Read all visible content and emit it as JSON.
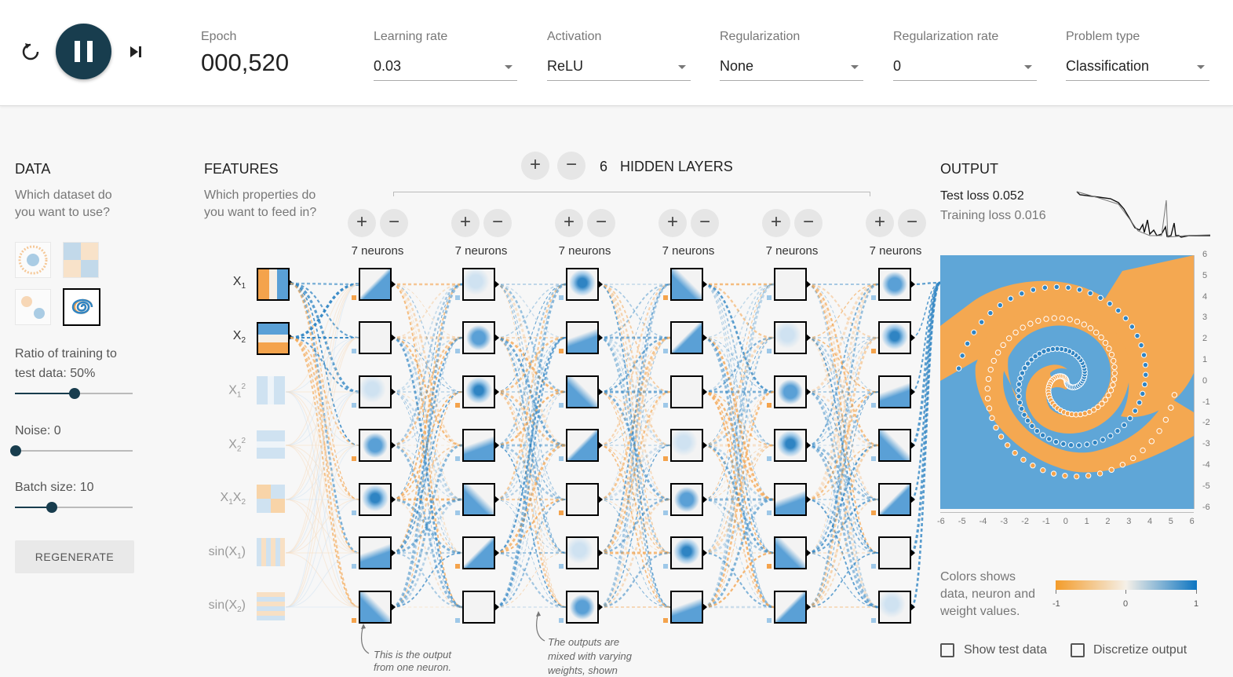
{
  "controls": {
    "epoch_label": "Epoch",
    "epoch_value": "000,520",
    "learning_rate_label": "Learning rate",
    "learning_rate_value": "0.03",
    "activation_label": "Activation",
    "activation_value": "ReLU",
    "regularization_label": "Regularization",
    "regularization_value": "None",
    "reg_rate_label": "Regularization rate",
    "reg_rate_value": "0",
    "problem_type_label": "Problem type",
    "problem_type_value": "Classification"
  },
  "data_panel": {
    "heading": "DATA",
    "question_line1": "Which dataset do",
    "question_line2": "you want to use?",
    "ratio_label_line1": "Ratio of training to",
    "ratio_label_line2": "test data:  50%",
    "ratio_value": 0.5,
    "noise_label": "Noise:  0",
    "noise_value": 0,
    "batch_label": "Batch size:  10",
    "batch_value": 10,
    "regenerate_label": "REGENERATE"
  },
  "features_panel": {
    "heading": "FEATURES",
    "question_line1": "Which properties do",
    "question_line2": "you want to feed in?"
  },
  "network": {
    "hidden_layers_count": "6",
    "hidden_layers_label": "HIDDEN LAYERS",
    "plus": "+",
    "minus": "−",
    "layers": [
      {
        "neurons": "7 neurons"
      },
      {
        "neurons": "7 neurons"
      },
      {
        "neurons": "7 neurons"
      },
      {
        "neurons": "7 neurons"
      },
      {
        "neurons": "7 neurons"
      },
      {
        "neurons": "7 neurons"
      }
    ],
    "annotation1_line1": "This is the output",
    "annotation1_line2": "from one neuron.",
    "annotation2_line1": "The outputs are",
    "annotation2_line2": "mixed with varying",
    "annotation2_line3": "weights, shown"
  },
  "output_panel": {
    "heading": "OUTPUT",
    "test_loss": "Test loss 0.052",
    "training_loss": "Training loss 0.016",
    "y_ticks": [
      "6",
      "5",
      "4",
      "3",
      "2",
      "1",
      "0",
      "-1",
      "-2",
      "-3",
      "-4",
      "-5",
      "-6"
    ],
    "x_ticks": [
      "-6",
      "-5",
      "-4",
      "-3",
      "-2",
      "-1",
      "0",
      "1",
      "2",
      "3",
      "4",
      "5",
      "6"
    ],
    "legend_text_line1": "Colors shows",
    "legend_text_line2": "data, neuron and",
    "legend_text_line3": "weight values.",
    "legend_min": "-1",
    "legend_mid": "0",
    "legend_max": "1",
    "show_test_data_label": "Show test data",
    "discretize_label": "Discretize output"
  },
  "colors": {
    "orange": "#f4a34c",
    "blue": "#2f84c3",
    "dark_button": "#183d4e"
  }
}
